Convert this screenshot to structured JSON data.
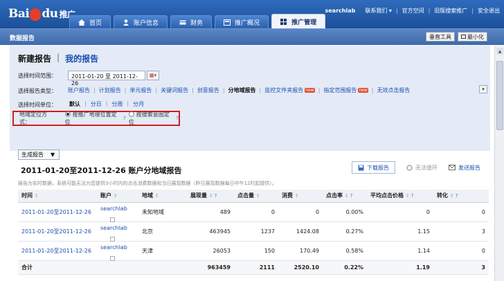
{
  "brand": {
    "logo_text": "Bai",
    "logo_text2": "du",
    "logo_suffix": "推广"
  },
  "toplinks": {
    "user": "searchlab",
    "items": [
      "联系我们 ▾",
      "官方空间",
      "旧版搜索推广",
      "安全退出"
    ]
  },
  "nav": {
    "tabs": [
      {
        "label": "首页",
        "icon": "home-icon"
      },
      {
        "label": "账户信息",
        "icon": "user-icon"
      },
      {
        "label": "财务",
        "icon": "wallet-icon"
      },
      {
        "label": "推广概况",
        "icon": "overview-icon"
      },
      {
        "label": "推广管理",
        "icon": "grid-icon",
        "active": true
      }
    ]
  },
  "panel": {
    "title": "数据报告",
    "buttons": [
      "垂直工具",
      "最小化"
    ]
  },
  "report_header": {
    "new_report": "新建报告",
    "separator": "|",
    "my_reports": "我的报告"
  },
  "time_range": {
    "label": "选择时间范围：",
    "value": "2011-01-20 至 2011-12-26"
  },
  "report_type": {
    "label": "选择报告类型：",
    "items": [
      "账户报告",
      "计划报告",
      "单元报告",
      "关键词报告",
      "创意报告",
      "分地域报告",
      "监控文件夹报告",
      "指定范围报告",
      "无效点击报告"
    ],
    "current": "分地域报告",
    "new_badge": "new"
  },
  "time_unit": {
    "label": "选择时间单位：",
    "items": [
      "默认",
      "分日",
      "分周",
      "分月"
    ],
    "current": "默认"
  },
  "region_method": {
    "label": "地域定位方式：",
    "options": [
      "按推广地理位置定位",
      "按搜索意图定位"
    ],
    "selected": "按推广地理位置定位",
    "help": "?"
  },
  "generate": {
    "label": "生成报告",
    "arrow": "▼"
  },
  "report": {
    "title": "2011-01-20至2011-12-26 账户分地域报告",
    "actions": {
      "download": "下载报告",
      "loop": "无法循环",
      "send": "发送报告"
    },
    "note": "报告为实时数据，系统可能无法为您提供3小时内的点击消费数据和当日展现数据（昨日展现数据每日中午12时起提供）。",
    "columns": [
      "时间",
      "账户",
      "地域",
      "展现量",
      "点击量",
      "消费",
      "点击率",
      "平均点击价格",
      "转化"
    ],
    "rows": [
      [
        "2011-01-20至2011-12-26",
        "searchlab",
        "未知地域",
        "489",
        "0",
        "0",
        "0.00%",
        "0",
        "0"
      ],
      [
        "2011-01-20至2011-12-26",
        "searchlab",
        "北京",
        "463945",
        "1237",
        "1424.08",
        "0.27%",
        "1.15",
        "3"
      ],
      [
        "2011-01-20至2011-12-26",
        "searchlab",
        "天津",
        "26053",
        "150",
        "170.49",
        "0.58%",
        "1.14",
        "0"
      ]
    ],
    "total": [
      "合计",
      "",
      "",
      "963459",
      "2111",
      "2520.10",
      "0.22%",
      "1.19",
      "3"
    ]
  },
  "colors": {
    "topbar": "#2f6bbd",
    "panel": "#4a76b7",
    "link": "#1a4fae",
    "highlight": "#cf1d1d",
    "section_bg": "#e4ebf7"
  }
}
